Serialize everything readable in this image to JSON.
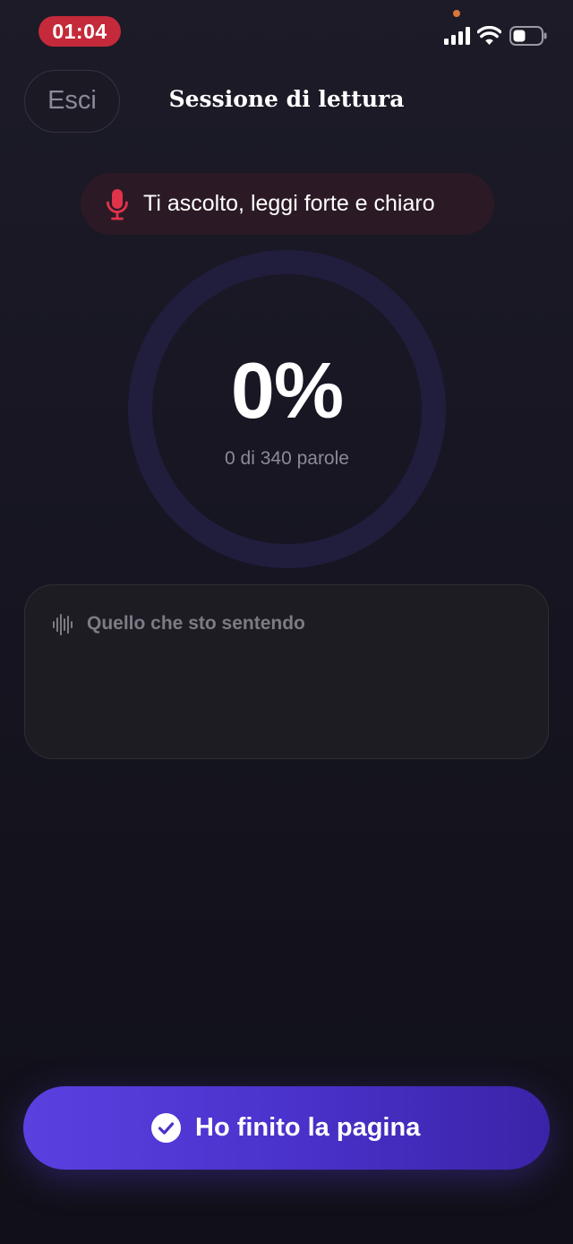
{
  "status_bar": {
    "time": "01:04",
    "icons": [
      "signal-icon",
      "wifi-icon",
      "battery-icon"
    ]
  },
  "header": {
    "exit_label": "Esci",
    "title": "Sessione di lettura"
  },
  "listening": {
    "icon": "microphone-icon",
    "text": "Ti ascolto, leggi forte e chiaro"
  },
  "progress": {
    "percent_label": "0%",
    "fraction": 0,
    "word_count_label": "0 di 340 parole"
  },
  "transcript": {
    "icon": "waveform-icon",
    "label": "Quello che sto sentendo",
    "content": ""
  },
  "finish": {
    "icon": "check-circle-icon",
    "label": "Ho finito la pagina"
  },
  "colors": {
    "accent": "#5b40e0",
    "recording": "#e0334a",
    "time_pill": "#c42a39",
    "ring_track": "#211d3d"
  }
}
